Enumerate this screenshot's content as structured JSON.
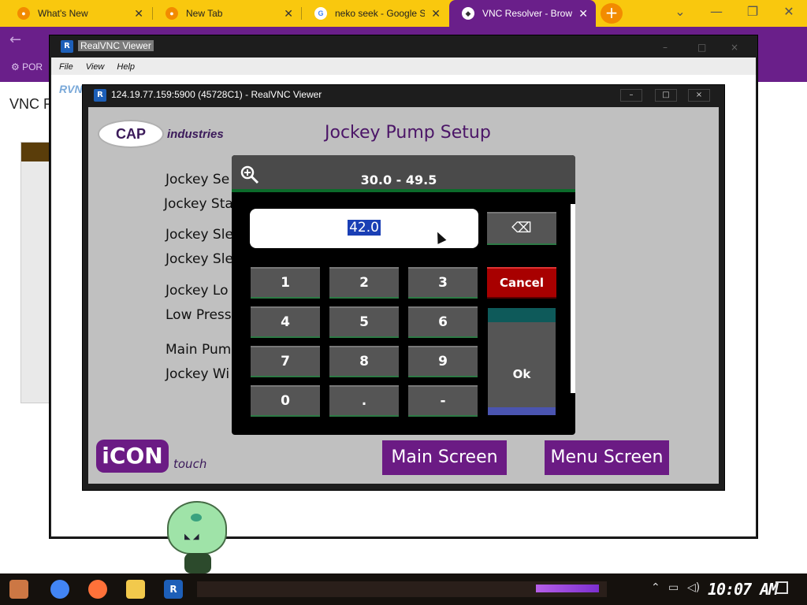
{
  "browser": {
    "tabs": [
      {
        "label": "What's New",
        "active": false
      },
      {
        "label": "New Tab",
        "active": false
      },
      {
        "label": "neko seek - Google Se",
        "active": false
      },
      {
        "label": "VNC Resolver - Brows",
        "active": true
      }
    ],
    "new_tab_label": "+",
    "window_controls": {
      "minimize": "—",
      "restore": "❐",
      "close": "✕",
      "dropdown": "⌄"
    },
    "bookmark_label": "POR",
    "page_title": "VNC Re",
    "colors": {
      "tabbar": "#f9c80e",
      "chrome": "#6a1f8a"
    }
  },
  "vnc_outer": {
    "title": "RealVNC Viewer",
    "menu": [
      "File",
      "View",
      "Help"
    ],
    "brand_text": "RVNC"
  },
  "vnc_inner": {
    "title": "124.19.77.159:5900 (45728C1) - RealVNC Viewer",
    "controls": {
      "minimize": "–",
      "maximize": "□",
      "close": "×"
    }
  },
  "hmi": {
    "title": "Jockey Pump Setup",
    "brand": {
      "logo": "CAP",
      "name": "industries"
    },
    "labels": [
      "Jockey Se",
      "Jockey Sta",
      "Jockey Sle",
      "Jockey Sle",
      "Jockey Lo",
      "Low Press",
      "Main Pum",
      "Jockey Wi"
    ],
    "footer_logo": "iCON",
    "footer_logo_sub": "touch",
    "buttons": {
      "main": "Main Screen",
      "menu": "Menu Screen"
    },
    "colors": {
      "accent": "#6b1b84",
      "background": "#c0c0c0"
    }
  },
  "keypad": {
    "range": "30.0 - 49.5",
    "value": "42.0",
    "zoom_icon": "zoom-in-icon",
    "keys": [
      "1",
      "2",
      "3",
      "4",
      "5",
      "6",
      "7",
      "8",
      "9",
      "0",
      ".",
      "-"
    ],
    "backspace": "⌫",
    "cancel": "Cancel",
    "ok": "Ok",
    "colors": {
      "cancel": "#a80000",
      "display_highlight": "#1a3fb5"
    }
  },
  "taskbar": {
    "clock": "10:07 AM",
    "tray_icons": [
      "chevron-up-icon",
      "network-icon",
      "volume-icon",
      "notification-icon"
    ],
    "apps": [
      "start-icon",
      "chrome-icon",
      "firefox-icon",
      "folder-icon",
      "realvnc-icon"
    ]
  }
}
